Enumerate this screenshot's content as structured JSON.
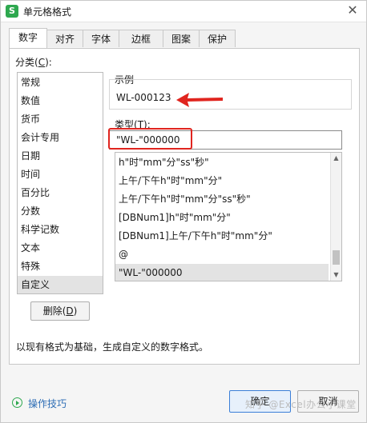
{
  "window": {
    "title": "单元格格式",
    "app_icon_letter": "S",
    "close_glyph": "✕"
  },
  "tabs": [
    {
      "label": "数字",
      "active": true
    },
    {
      "label": "对齐",
      "active": false
    },
    {
      "label": "字体",
      "active": false
    },
    {
      "label": "边框",
      "active": false
    },
    {
      "label": "图案",
      "active": false
    },
    {
      "label": "保护",
      "active": false
    }
  ],
  "category": {
    "label_prefix": "分类(",
    "label_key": "C",
    "label_suffix": "):",
    "items": [
      "常规",
      "数值",
      "货币",
      "会计专用",
      "日期",
      "时间",
      "百分比",
      "分数",
      "科学记数",
      "文本",
      "特殊",
      "自定义"
    ],
    "selected": "自定义"
  },
  "delete_button": {
    "label_prefix": "删除(",
    "label_key": "D",
    "label_suffix": ")"
  },
  "sample": {
    "label": "示例",
    "value": "WL-000123"
  },
  "type": {
    "label_prefix": "类型(",
    "label_key": "T",
    "label_suffix": "):",
    "value": "\"WL-\"000000"
  },
  "format_list": {
    "items": [
      "h\"时\"mm\"分\"ss\"秒\"",
      "上午/下午h\"时\"mm\"分\"",
      "上午/下午h\"时\"mm\"分\"ss\"秒\"",
      "[DBNum1]h\"时\"mm\"分\"",
      "[DBNum1]上午/下午h\"时\"mm\"分\"",
      "@",
      "\"WL-\"000000"
    ],
    "selected_index": 6,
    "scroll_up_glyph": "▲",
    "scroll_down_glyph": "▼"
  },
  "description": "以现有格式为基础，生成自定义的数字格式。",
  "footer": {
    "help_label": "操作技巧",
    "ok_label": "确定",
    "cancel_label": "取消",
    "watermark": "知乎 @Excel办公小课堂"
  },
  "colors": {
    "highlight_red": "#e0251f",
    "accent_green": "#2ea84f",
    "link_blue": "#2d6db5"
  }
}
